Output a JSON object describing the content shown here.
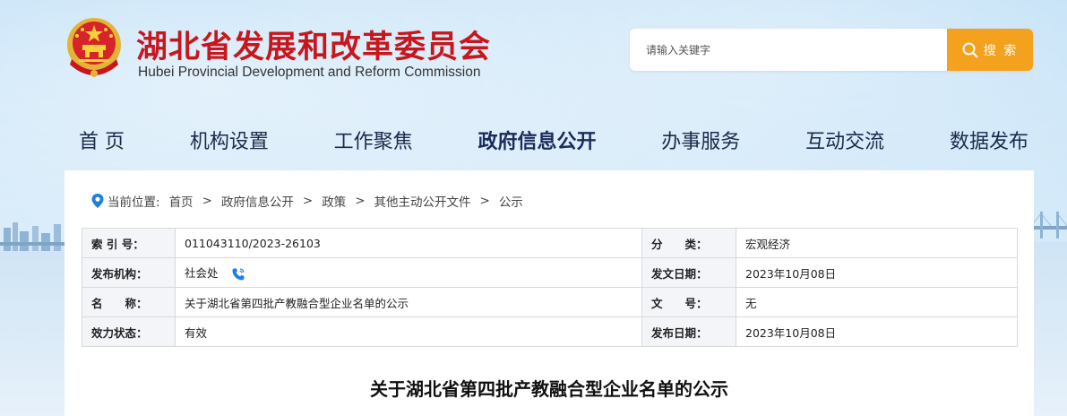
{
  "header": {
    "title": "湖北省发展和改革委员会",
    "subtitle": "Hubei Provincial Development and Reform Commission"
  },
  "search": {
    "placeholder": "请输入关键字",
    "button_label": "搜 索"
  },
  "nav": {
    "items": [
      {
        "label": "首 页"
      },
      {
        "label": "机构设置"
      },
      {
        "label": "工作聚焦"
      },
      {
        "label": "政府信息公开"
      },
      {
        "label": "办事服务"
      },
      {
        "label": "互动交流"
      },
      {
        "label": "数据发布"
      }
    ],
    "active_index": 3
  },
  "breadcrumb": {
    "prefix": "当前位置:",
    "items": [
      "首页",
      "政府信息公开",
      "政策",
      "其他主动公开文件",
      "公示"
    ],
    "separator": ">"
  },
  "meta": {
    "index_no_label": "索 引 号：",
    "index_no": "011043110/2023-26103",
    "category_label": "分　　类：",
    "category": "宏观经济",
    "publisher_label": "发布机构：",
    "publisher": "社会处",
    "doc_date_label": "发文日期：",
    "doc_date": "2023年10月08日",
    "name_label": "名　　称：",
    "name": "关于湖北省第四批产教融合型企业名单的公示",
    "doc_no_label": "文　　号：",
    "doc_no": "无",
    "status_label": "效力状态：",
    "status": "有效",
    "pub_date_label": "发布日期：",
    "pub_date": "2023年10月08日"
  },
  "document": {
    "title": "关于湖北省第四批产教融合型企业名单的公示"
  },
  "colors": {
    "title_red": "#c8161d",
    "search_orange": "#f4a21e",
    "pin_blue": "#1e7fe0"
  }
}
